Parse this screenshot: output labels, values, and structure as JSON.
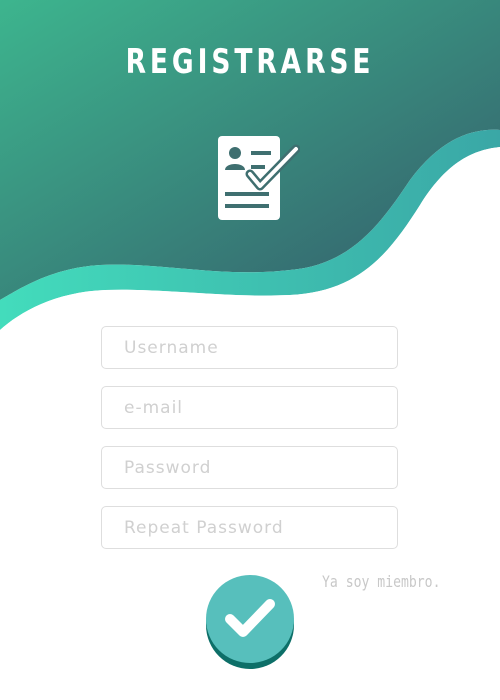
{
  "header": {
    "title": "REGISTRARSE",
    "icon": "registration-document-icon",
    "gradient_start": "#3db58e",
    "gradient_end": "#345a6a",
    "wave_highlight_start": "#43dcbc",
    "wave_highlight_end": "#3aa7a6"
  },
  "form": {
    "username_placeholder": "Username",
    "email_placeholder": "e-mail",
    "password_placeholder": "Password",
    "repeat_password_placeholder": "Repeat Password"
  },
  "actions": {
    "member_link": "Ya soy miembro.",
    "submit_icon": "checkmark-icon",
    "submit_color": "#57bfbc"
  }
}
